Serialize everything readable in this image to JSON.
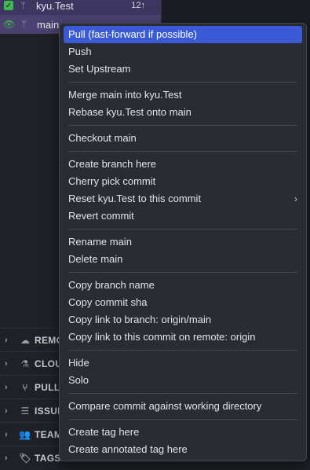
{
  "branches": [
    {
      "name": "kyu.Test",
      "count": "12↑",
      "icon": "git-branch-icon",
      "status_icon": "checkbox-checked-icon"
    },
    {
      "name": "main",
      "icon": "git-branch-icon",
      "status_icon": "eye-icon"
    }
  ],
  "sections": [
    {
      "label": "REMO",
      "icon": "cloud-icon"
    },
    {
      "label": "CLOU",
      "icon": "flask-icon"
    },
    {
      "label": "PULL",
      "icon": "pull-request-icon"
    },
    {
      "label": "ISSUI",
      "icon": "list-icon"
    },
    {
      "label": "TEAM",
      "icon": "team-icon"
    },
    {
      "label": "TAGS",
      "icon": "tag-icon"
    }
  ],
  "menu": {
    "groups": [
      [
        "Pull (fast-forward if possible)",
        "Push",
        "Set Upstream"
      ],
      [
        "Merge main into kyu.Test",
        "Rebase kyu.Test onto main"
      ],
      [
        "Checkout main"
      ],
      [
        "Create branch here",
        "Cherry pick commit",
        "Reset kyu.Test to this commit",
        "Revert commit"
      ],
      [
        "Rename main",
        "Delete main"
      ],
      [
        "Copy branch name",
        "Copy commit sha",
        "Copy link to branch: origin/main",
        "Copy link to this commit on remote: origin"
      ],
      [
        "Hide",
        "Solo"
      ],
      [
        "Compare commit against working directory"
      ],
      [
        "Create tag here",
        "Create annotated tag here"
      ]
    ],
    "highlighted": "Pull (fast-forward if possible)",
    "submenu_item": "Reset kyu.Test to this commit"
  },
  "colors": {
    "highlight": "#3b5bd6",
    "menu_bg": "#2a2c33",
    "branch_active": "#4a4170",
    "check": "#3fb950"
  }
}
